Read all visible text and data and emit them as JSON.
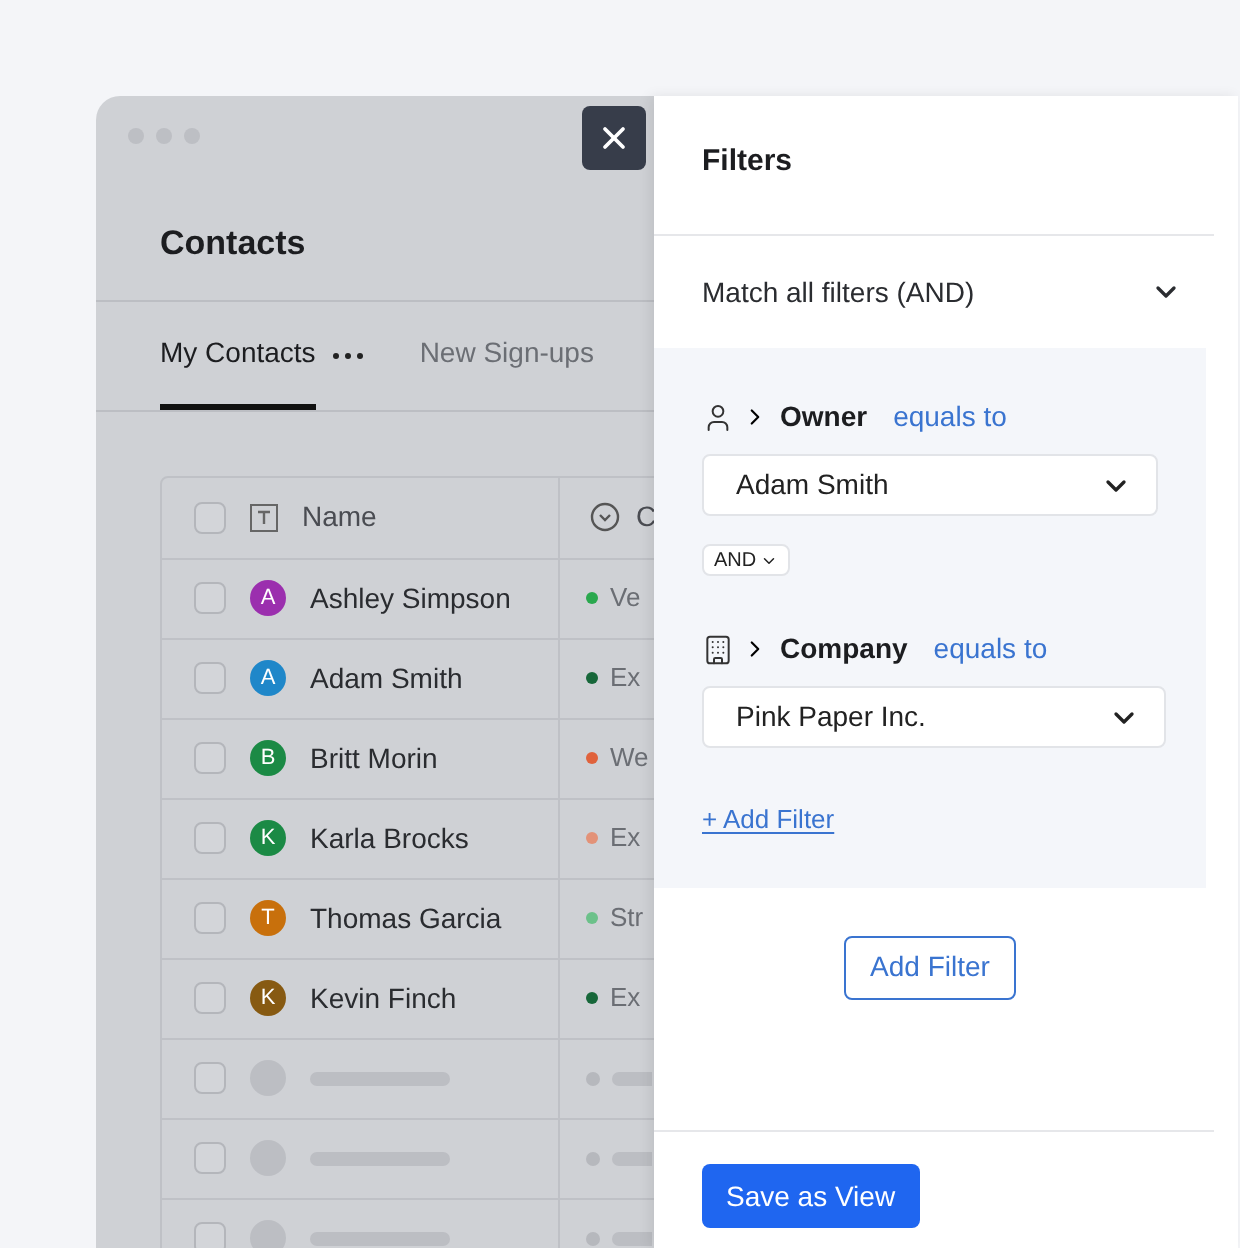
{
  "window": {
    "title": "Contacts"
  },
  "tabs": [
    {
      "label": "My Contacts",
      "selected": true
    },
    {
      "label": "New Sign-ups",
      "selected": false
    }
  ],
  "table": {
    "columns": [
      "Name",
      "C"
    ],
    "select_all": {
      "checked": false
    },
    "rows": [
      {
        "kind": "contact",
        "checked": false,
        "avatar": {
          "initial": "A",
          "color": "#9b2fae"
        },
        "name": "Ashley Simpson",
        "status": {
          "text": "Ve",
          "color": "#2aa84e"
        }
      },
      {
        "kind": "contact",
        "checked": false,
        "avatar": {
          "initial": "A",
          "color": "#1f87c9"
        },
        "name": "Adam Smith",
        "status": {
          "text": "Ex",
          "color": "#17673a"
        }
      },
      {
        "kind": "contact",
        "checked": false,
        "avatar": {
          "initial": "B",
          "color": "#1b8a45"
        },
        "name": "Britt Morin",
        "status": {
          "text": "We",
          "color": "#e0623c"
        }
      },
      {
        "kind": "contact",
        "checked": false,
        "avatar": {
          "initial": "K",
          "color": "#1b8a45"
        },
        "name": "Karla Brocks",
        "status": {
          "text": "Ex",
          "color": "#e39278"
        }
      },
      {
        "kind": "contact",
        "checked": false,
        "avatar": {
          "initial": "T",
          "color": "#c8700c"
        },
        "name": "Thomas Garcia",
        "status": {
          "text": "Str",
          "color": "#6cc18a"
        }
      },
      {
        "kind": "contact",
        "checked": false,
        "avatar": {
          "initial": "K",
          "color": "#875a12"
        },
        "name": "Kevin Finch",
        "status": {
          "text": "Ex",
          "color": "#17673a"
        }
      },
      {
        "kind": "placeholder",
        "checked": false
      },
      {
        "kind": "placeholder",
        "checked": false
      },
      {
        "kind": "placeholder",
        "checked": false
      }
    ]
  },
  "filters_panel": {
    "title": "Filters",
    "match": "Match all filters (AND)",
    "filters": [
      {
        "kind": "person",
        "field": "Owner",
        "operator": "equals to",
        "value": "Adam Smith"
      },
      {
        "kind": "building",
        "field": "Company",
        "operator": "equals to",
        "value": "Pink Paper Inc."
      }
    ],
    "joiner": "AND",
    "add_link": "+ Add Filter",
    "add_button": "Add Filter",
    "save_button": "Save as View"
  }
}
